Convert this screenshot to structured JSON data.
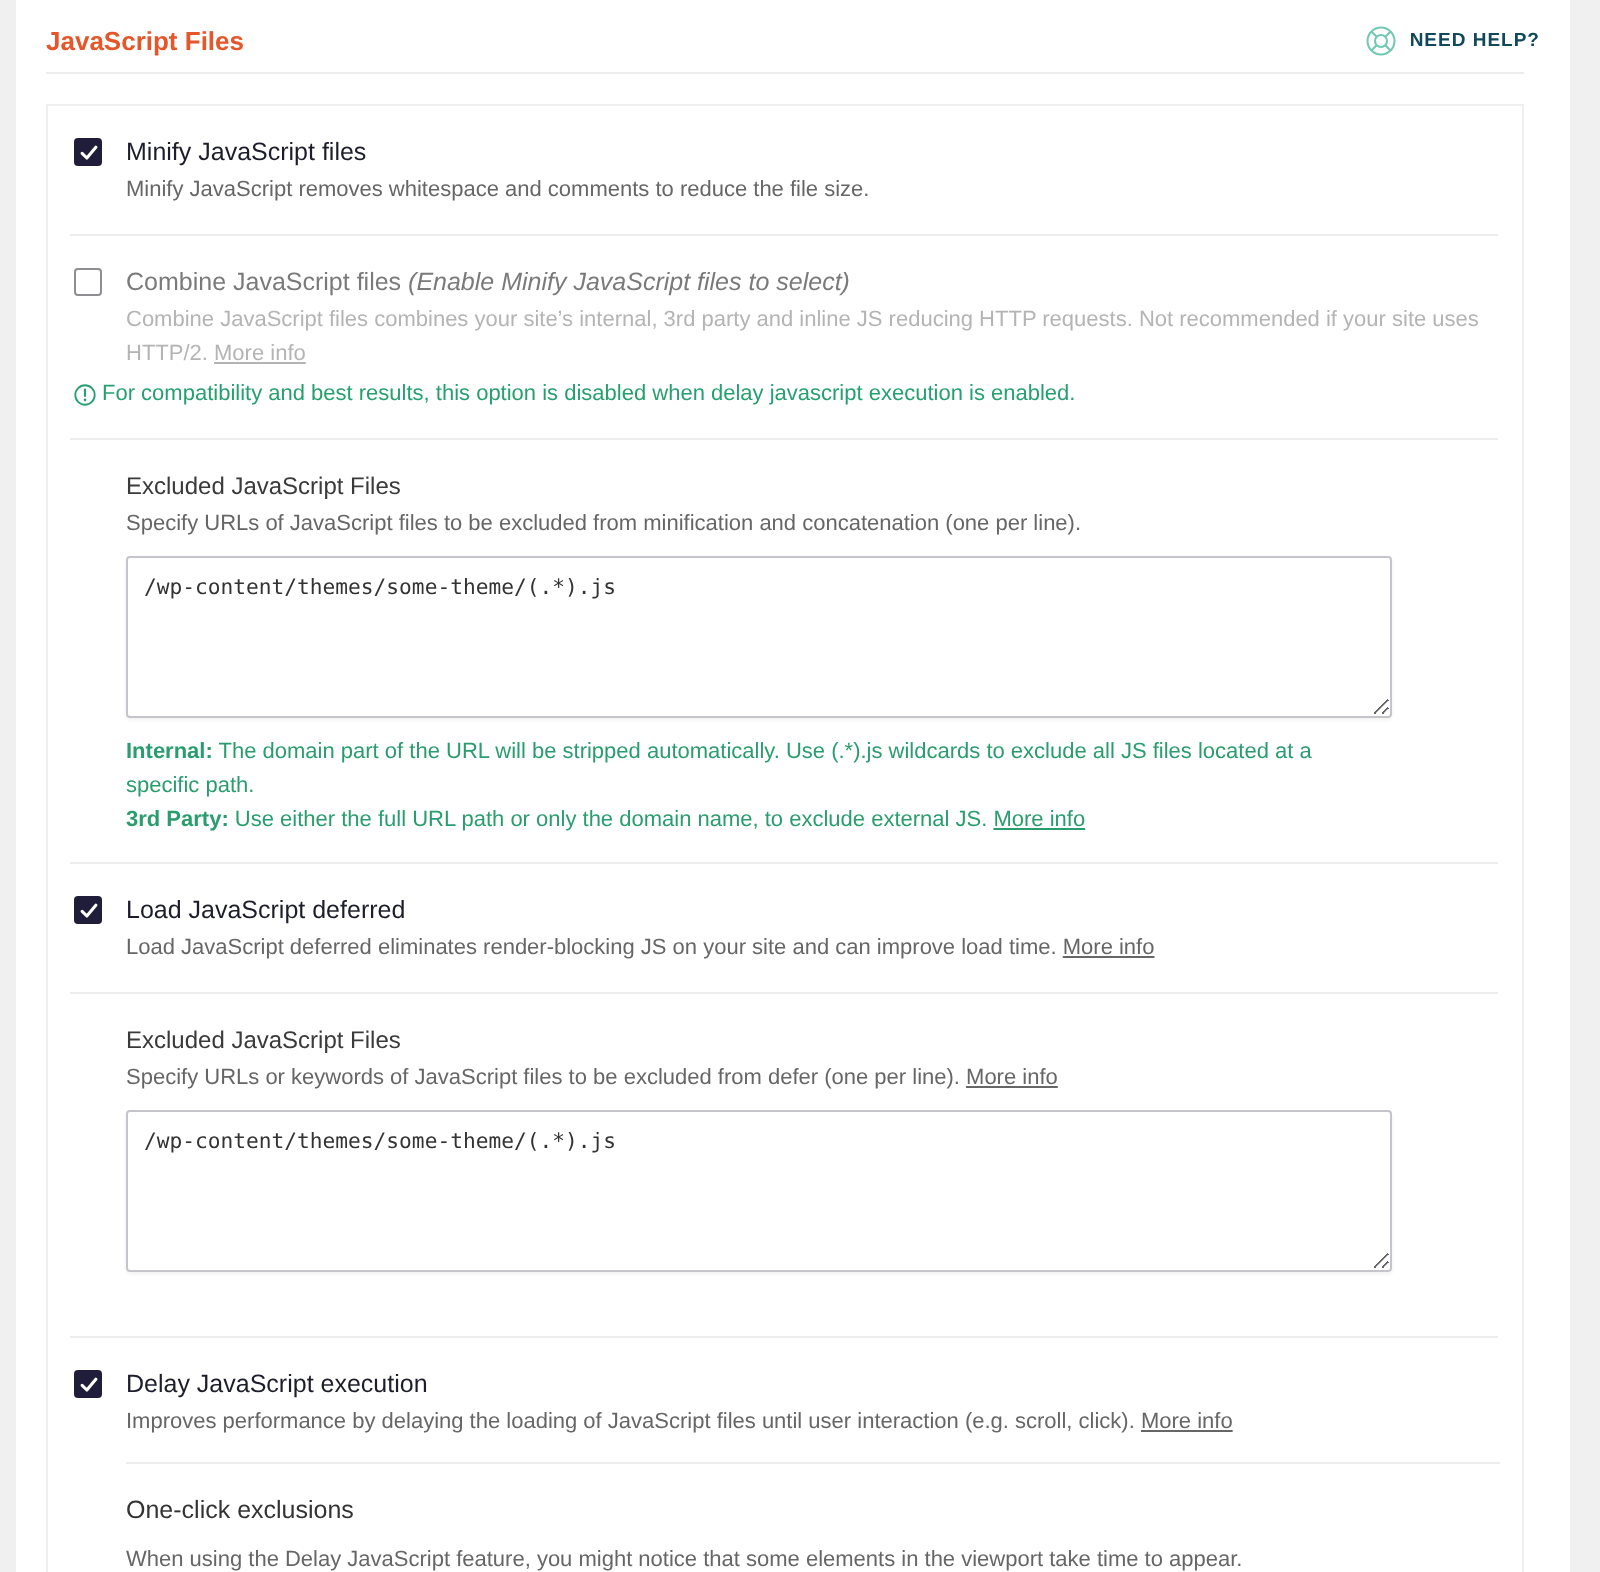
{
  "header": {
    "title": "JavaScript Files",
    "help_link": "NEED HELP?"
  },
  "settings": [
    {
      "kind": "option",
      "label": "Minify JavaScript files",
      "checked": true,
      "disabled": false,
      "description": "Minify JavaScript removes whitespace and comments to reduce the file size."
    },
    {
      "kind": "option",
      "label": "Combine JavaScript files *(Enable Minify JavaScript files to select)*",
      "checked": false,
      "disabled": true,
      "description": "Combine JavaScript files combines your site’s internal, 3rd party and inline JS reducing HTTP requests. Not recommended if your site uses HTTP/2.",
      "link": "More info",
      "notice": "For compatibility and best results, this option is disabled when delay javascript execution is enabled."
    },
    {
      "kind": "field",
      "label": "Excluded JavaScript Files",
      "description": "Specify URLs of JavaScript files to be excluded from minification and concatenation (one per line).",
      "value": "/wp-content/themes/some-theme/(.*).js",
      "notes": [
        {
          "text": "**Internal:** The domain part of the URL will be stripped automatically. Use (.*).js wildcards to exclude all JS files located at a specific path."
        },
        {
          "text": "**3rd Party:** Use either the full URL path or only the domain name, to exclude external JS.",
          "link": "More info"
        }
      ]
    },
    {
      "kind": "option",
      "label": "Load JavaScript deferred",
      "checked": true,
      "disabled": false,
      "description": "Load JavaScript deferred eliminates render-blocking JS on your site and can improve load time.",
      "link": "More info"
    },
    {
      "kind": "field",
      "label": "Excluded JavaScript Files",
      "description": "Specify URLs or keywords of JavaScript files to be excluded from defer (one per line).",
      "link": "More info",
      "value": "/wp-content/themes/some-theme/(.*).js"
    },
    {
      "kind": "option",
      "label": "Delay JavaScript execution",
      "checked": true,
      "disabled": false,
      "description": "Improves performance by delaying the loading of JavaScript files until user interaction (e.g. scroll, click).",
      "link": "More info",
      "children": [
        {
          "kind": "subsection",
          "title": "One-click exclusions",
          "text": "When using the Delay JavaScript feature, you might notice that some elements in the viewport take time to appear."
        }
      ]
    }
  ]
}
